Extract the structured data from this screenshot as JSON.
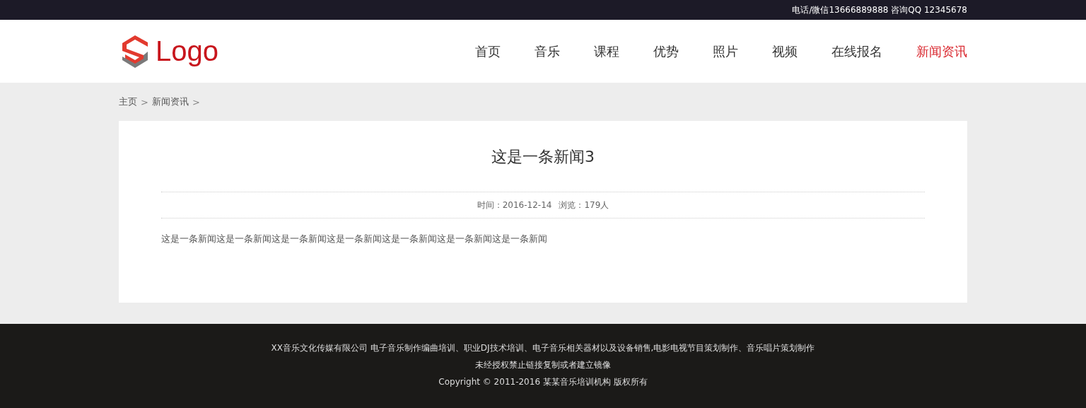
{
  "top_bar": {
    "contact": "电话/微信13666889888 咨询QQ 12345678"
  },
  "header": {
    "logo_text": "Logo",
    "nav": [
      {
        "label": "首页",
        "selected": false
      },
      {
        "label": "音乐",
        "selected": false
      },
      {
        "label": "课程",
        "selected": false
      },
      {
        "label": "优势",
        "selected": false
      },
      {
        "label": "照片",
        "selected": false
      },
      {
        "label": "视频",
        "selected": false
      },
      {
        "label": "在线报名",
        "selected": false
      },
      {
        "label": "新闻资讯",
        "selected": true
      }
    ]
  },
  "breadcrumb": [
    {
      "kind": "link",
      "text": "主页"
    },
    {
      "kind": "separator",
      "text": ">"
    },
    {
      "kind": "link",
      "text": "新闻资讯"
    },
    {
      "kind": "separator",
      "text": ">"
    }
  ],
  "article": {
    "title": "这是一条新闻3",
    "date": "时间：2016-12-14",
    "views": "浏览：179人",
    "body": "这是一条新闻这是一条新闻这是一条新闻这是一条新闻这是一条新闻这是一条新闻这是一条新闻"
  },
  "footer": {
    "lines": [
      "XX音乐文化传媒有限公司 电子音乐制作编曲培训、职业DJ技术培训、电子音乐相关器材以及设备销售,电影电视节目策划制作、音乐唱片策划制作",
      "未经授权禁止链接复制或者建立镜像",
      "Copyright © 2011-2016 某某音乐培训机构 版权所有"
    ]
  }
}
